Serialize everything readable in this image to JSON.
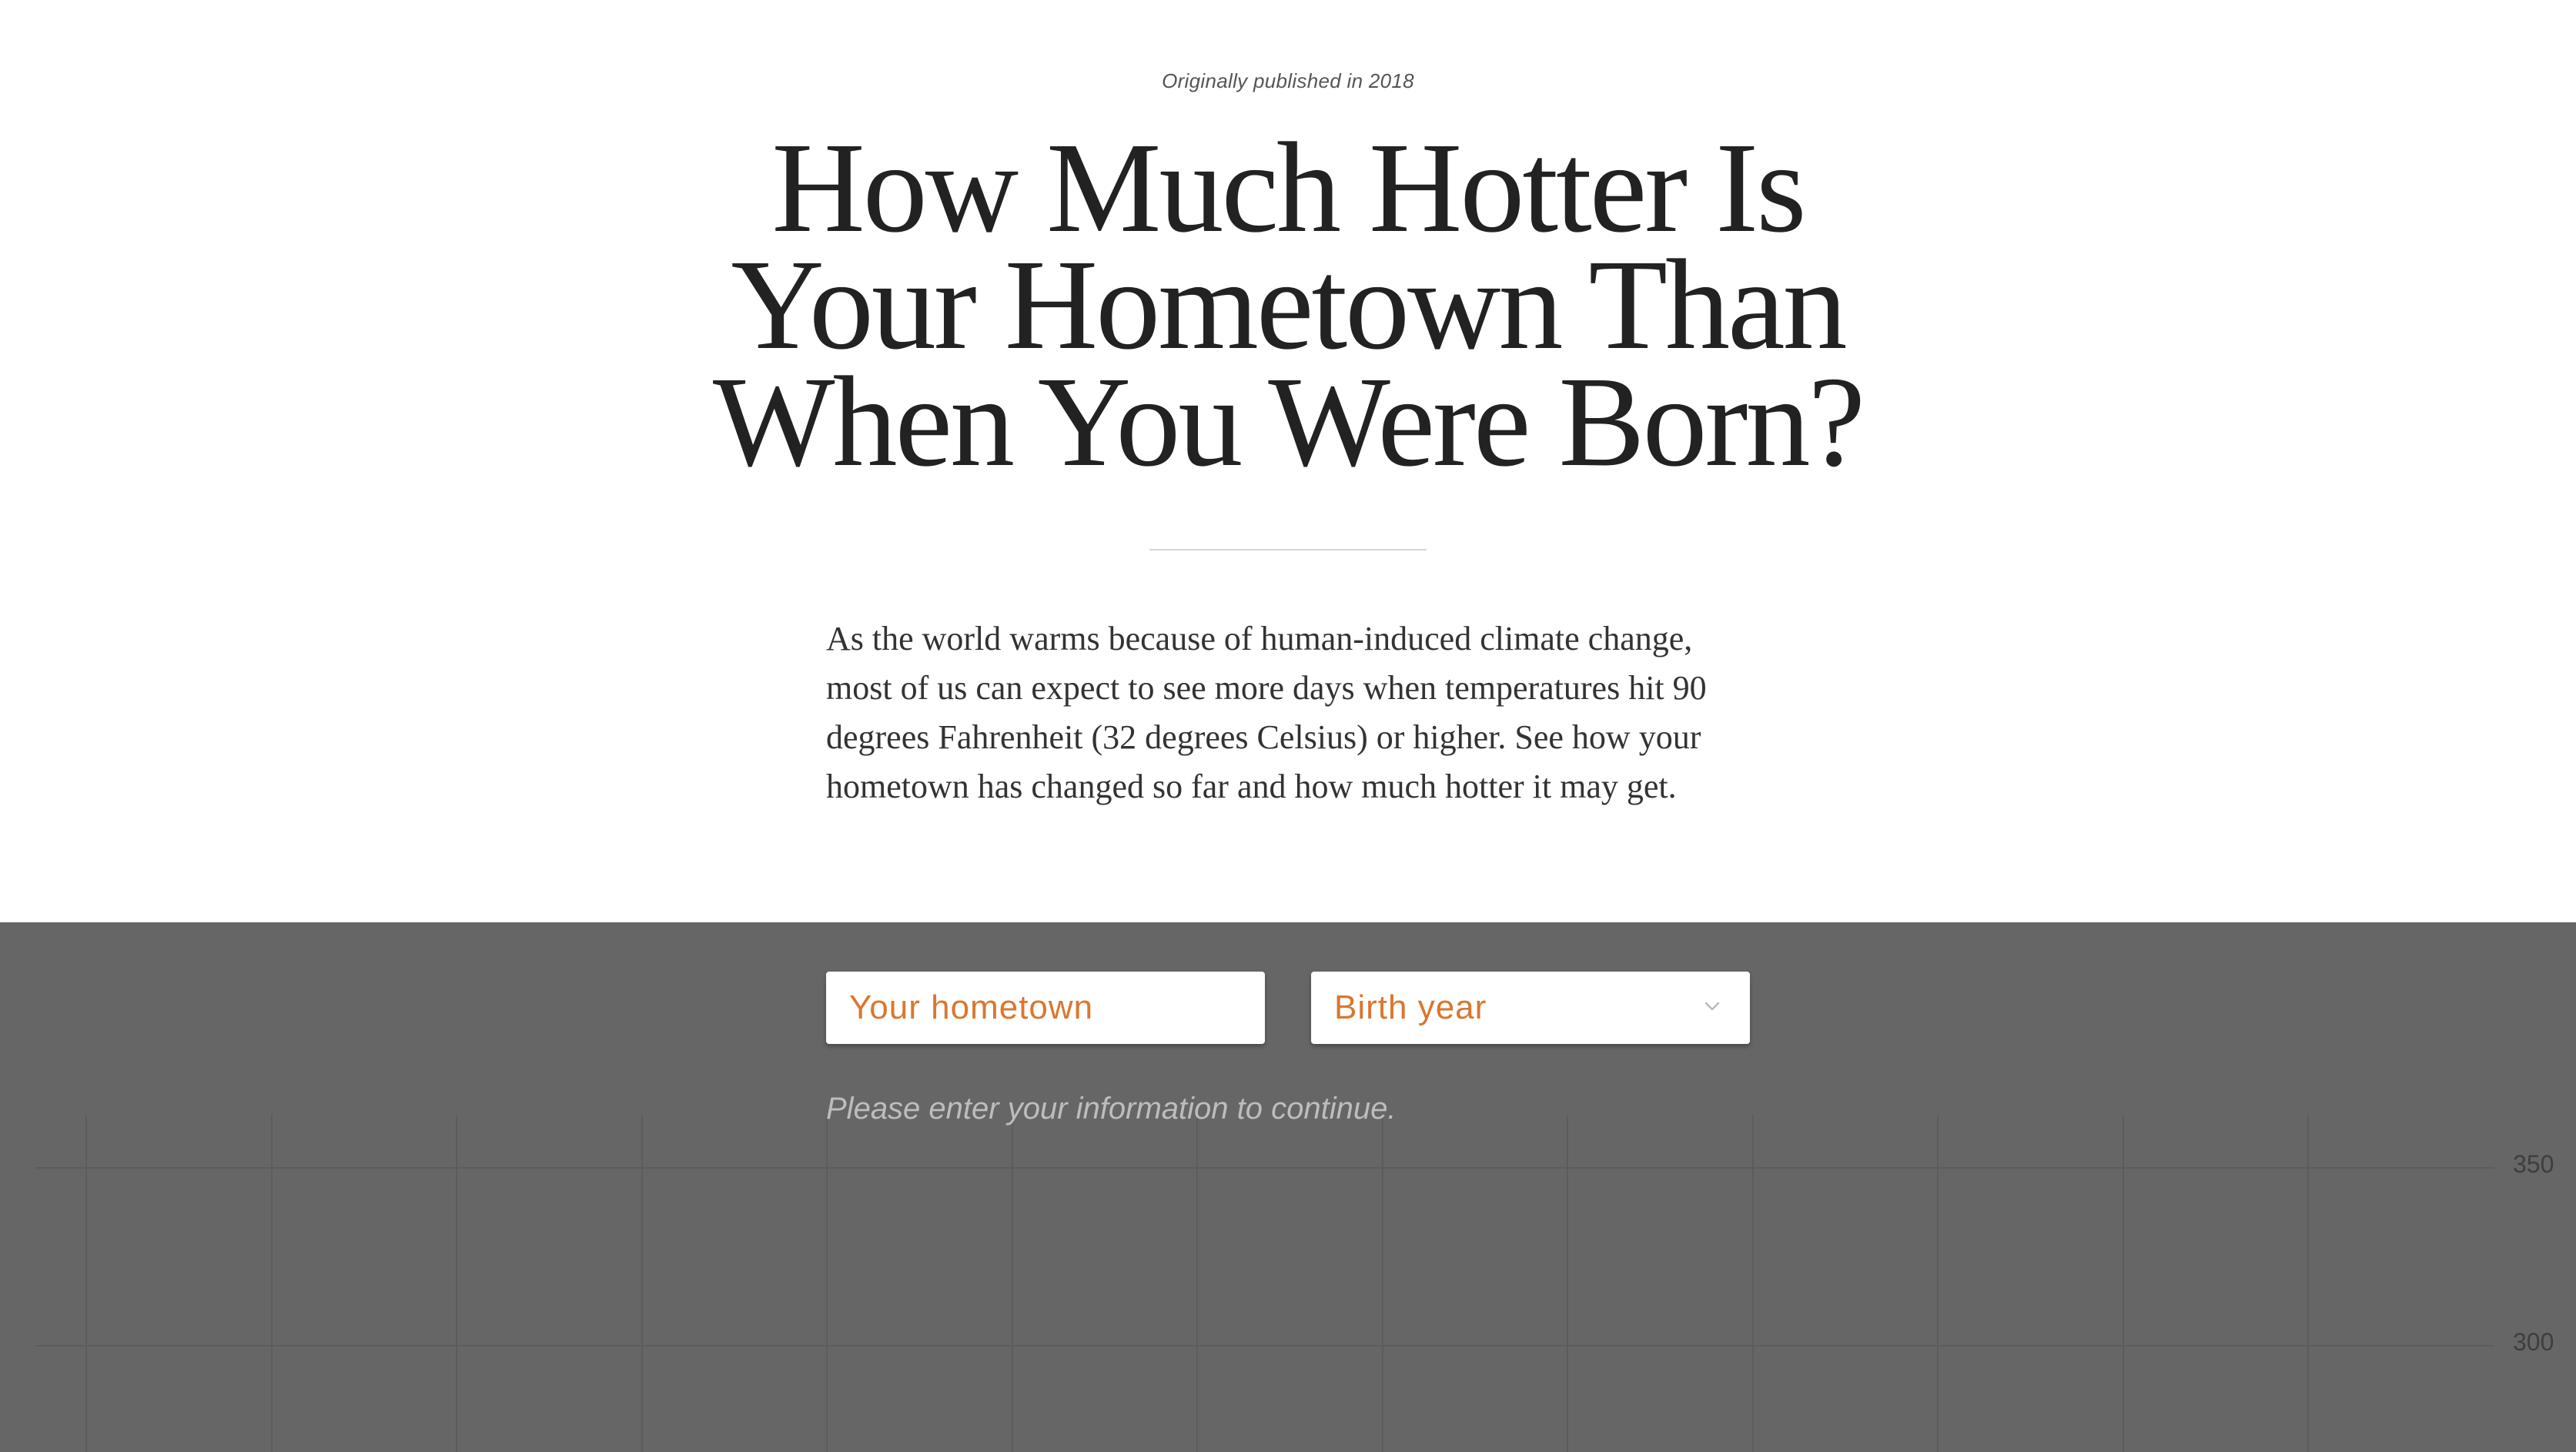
{
  "article": {
    "kicker": "Originally published in 2018",
    "headline": "How Much Hotter Is Your Hometown Than When You Were Born?",
    "summary": "As the world warms because of human-induced climate change, most of us can expect to see more days when temperatures hit 90 degrees Fahrenheit (32 degrees Celsius) or higher. See how your hometown has changed so far and how much hotter it may get."
  },
  "form": {
    "hometown_placeholder": "Your hometown",
    "hometown_value": "",
    "birth_year_label": "Birth year",
    "birth_year_icon": "chevron-down-icon",
    "prompt": "Please enter your information to continue."
  },
  "chart_data": {
    "type": "line",
    "y_ticks": [
      "350",
      "300"
    ],
    "grid": true
  },
  "colors": {
    "panel_background": "#666666",
    "accent": "#d9772f",
    "headline_text": "#222222"
  }
}
